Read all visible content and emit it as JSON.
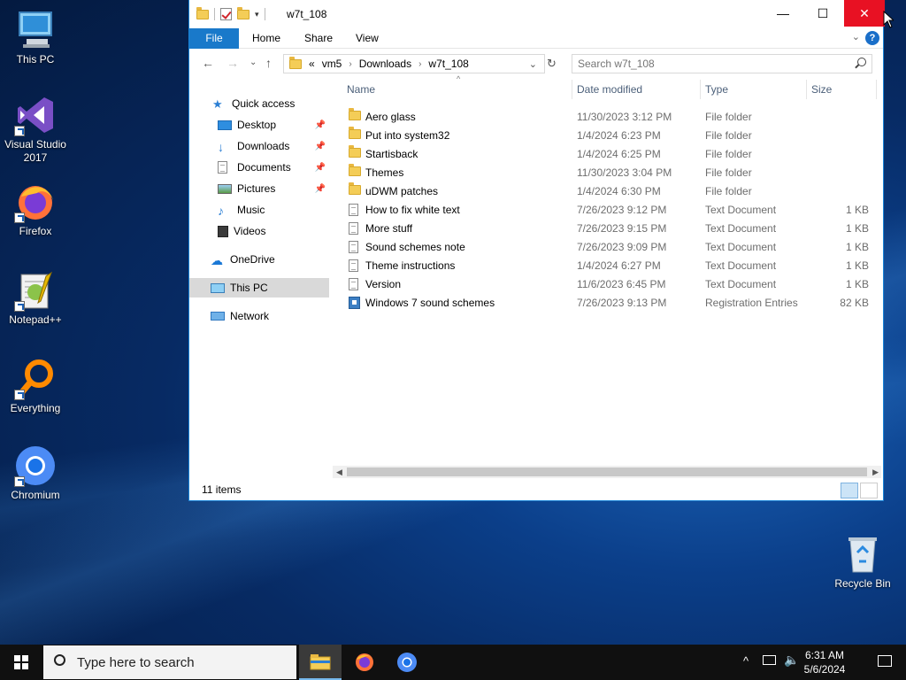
{
  "desktop": {
    "icons": [
      {
        "label": "This PC"
      },
      {
        "label": "Visual Studio 2017"
      },
      {
        "label": "Firefox"
      },
      {
        "label": "Notepad++"
      },
      {
        "label": "Everything"
      },
      {
        "label": "Chromium"
      },
      {
        "label": "Recycle Bin"
      }
    ]
  },
  "window": {
    "title": "w7t_108",
    "controls": {
      "minimize": "—",
      "maximize": "☐",
      "close": "✕"
    },
    "ribbon": {
      "file": "File",
      "tabs": [
        "Home",
        "Share",
        "View"
      ],
      "help": "?"
    },
    "address": {
      "prefix": "«",
      "segments": [
        "vm5",
        "Downloads",
        "w7t_108"
      ]
    },
    "search": {
      "placeholder": "Search w7t_108"
    },
    "nav": {
      "quick_access": "Quick access",
      "quick_items": [
        "Desktop",
        "Downloads",
        "Documents",
        "Pictures",
        "Music",
        "Videos"
      ],
      "onedrive": "OneDrive",
      "this_pc": "This PC",
      "network": "Network"
    },
    "columns": {
      "name": "Name",
      "date": "Date modified",
      "type": "Type",
      "size": "Size"
    },
    "files": [
      {
        "name": "Aero glass",
        "date": "11/30/2023 3:12 PM",
        "type": "File folder",
        "size": "",
        "kind": "folder"
      },
      {
        "name": "Put into system32",
        "date": "1/4/2024 6:23 PM",
        "type": "File folder",
        "size": "",
        "kind": "folder"
      },
      {
        "name": "Startisback",
        "date": "1/4/2024 6:25 PM",
        "type": "File folder",
        "size": "",
        "kind": "folder"
      },
      {
        "name": "Themes",
        "date": "11/30/2023 3:04 PM",
        "type": "File folder",
        "size": "",
        "kind": "folder"
      },
      {
        "name": "uDWM patches",
        "date": "1/4/2024 6:30 PM",
        "type": "File folder",
        "size": "",
        "kind": "folder"
      },
      {
        "name": "How to fix white text",
        "date": "7/26/2023 9:12 PM",
        "type": "Text Document",
        "size": "1 KB",
        "kind": "doc"
      },
      {
        "name": "More stuff",
        "date": "7/26/2023 9:15 PM",
        "type": "Text Document",
        "size": "1 KB",
        "kind": "doc"
      },
      {
        "name": "Sound schemes note",
        "date": "7/26/2023 9:09 PM",
        "type": "Text Document",
        "size": "1 KB",
        "kind": "doc"
      },
      {
        "name": "Theme instructions",
        "date": "1/4/2024 6:27 PM",
        "type": "Text Document",
        "size": "1 KB",
        "kind": "doc"
      },
      {
        "name": "Version",
        "date": "11/6/2023 6:45 PM",
        "type": "Text Document",
        "size": "1 KB",
        "kind": "doc"
      },
      {
        "name": "Windows 7 sound schemes",
        "date": "7/26/2023 9:13 PM",
        "type": "Registration Entries",
        "size": "82 KB",
        "kind": "reg"
      }
    ],
    "status": "11 items"
  },
  "taskbar": {
    "search_placeholder": "Type here to search",
    "time": "6:31 AM",
    "date": "5/6/2024"
  },
  "colors": {
    "accent": "#1979ca",
    "close": "#e81123",
    "taskbar": "#101010"
  }
}
